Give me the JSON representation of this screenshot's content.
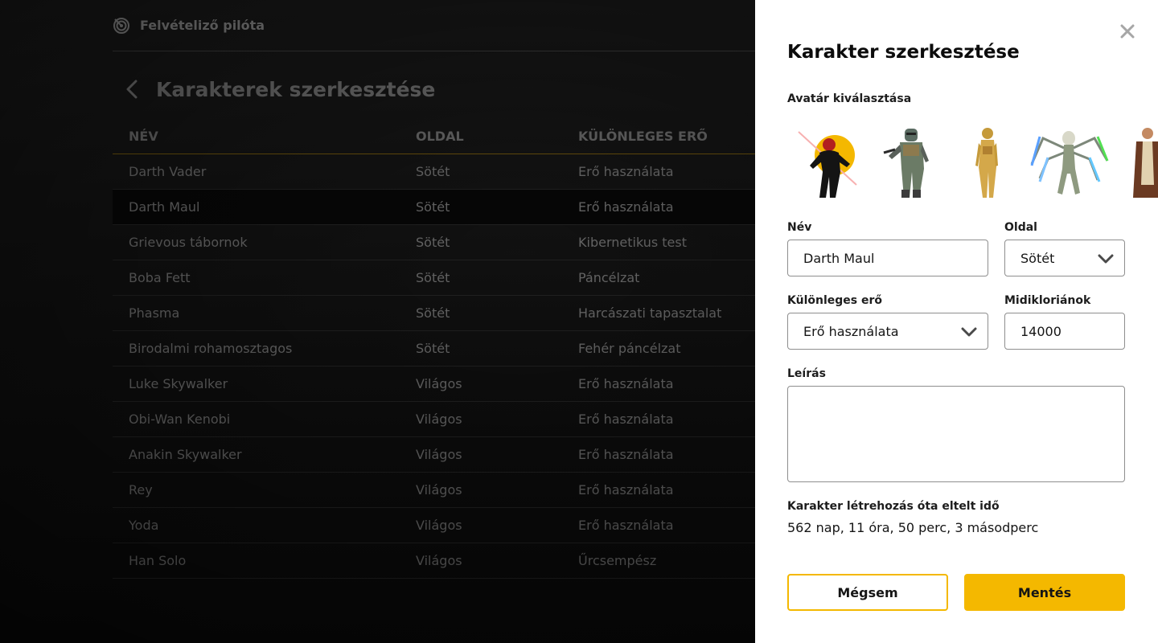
{
  "app": {
    "name": "Felvételiző pilóta",
    "logo_icon": "radar-icon"
  },
  "page": {
    "title": "Karakterek szerkesztése",
    "back_icon": "chevron-left-icon"
  },
  "table": {
    "headers": [
      "NÉV",
      "OLDAL",
      "KÜLÖNLEGES ERŐ"
    ],
    "rows": [
      {
        "name": "Darth Vader",
        "side": "Sötét",
        "power": "Erő használata"
      },
      {
        "name": "Darth Maul",
        "side": "Sötét",
        "power": "Erő használata"
      },
      {
        "name": "Grievous tábornok",
        "side": "Sötét",
        "power": "Kibernetikus test"
      },
      {
        "name": "Boba Fett",
        "side": "Sötét",
        "power": "Páncélzat"
      },
      {
        "name": "Phasma",
        "side": "Sötét",
        "power": "Harcászati tapasztalat"
      },
      {
        "name": "Birodalmi rohamosztagos",
        "side": "Sötét",
        "power": "Fehér páncélzat"
      },
      {
        "name": "Luke Skywalker",
        "side": "Világos",
        "power": "Erő használata"
      },
      {
        "name": "Obi-Wan Kenobi",
        "side": "Világos",
        "power": "Erő használata"
      },
      {
        "name": "Anakin Skywalker",
        "side": "Világos",
        "power": "Erő használata"
      },
      {
        "name": "Rey",
        "side": "Világos",
        "power": "Erő használata"
      },
      {
        "name": "Yoda",
        "side": "Világos",
        "power": "Erő használata"
      },
      {
        "name": "Han Solo",
        "side": "Világos",
        "power": "Űrcsempész"
      }
    ]
  },
  "drawer": {
    "title": "Karakter szerkesztése",
    "close_icon": "close-icon",
    "avatar_label": "Avatár kiválasztása",
    "avatars": [
      "darth-maul-avatar",
      "boba-fett-avatar",
      "c3po-avatar",
      "grievous-avatar",
      "obi-wan-avatar"
    ],
    "name_label": "Név",
    "name_value": "Darth Maul",
    "side_label": "Oldal",
    "side_value": "Sötét",
    "power_label": "Különleges erő",
    "power_value": "Erő használata",
    "midi_label": "Midikloriánok",
    "midi_value": "14000",
    "description_label": "Leírás",
    "description_value": "",
    "elapsed_label": "Karakter létrehozás óta eltelt idő",
    "elapsed_value": "562 nap, 11 óra, 50 perc, 3 másodperc",
    "cancel_label": "Mégsem",
    "save_label": "Mentés"
  },
  "colors": {
    "accent": "#f4b800",
    "drawer_bg": "#ffffff",
    "page_bg": "#151515"
  }
}
